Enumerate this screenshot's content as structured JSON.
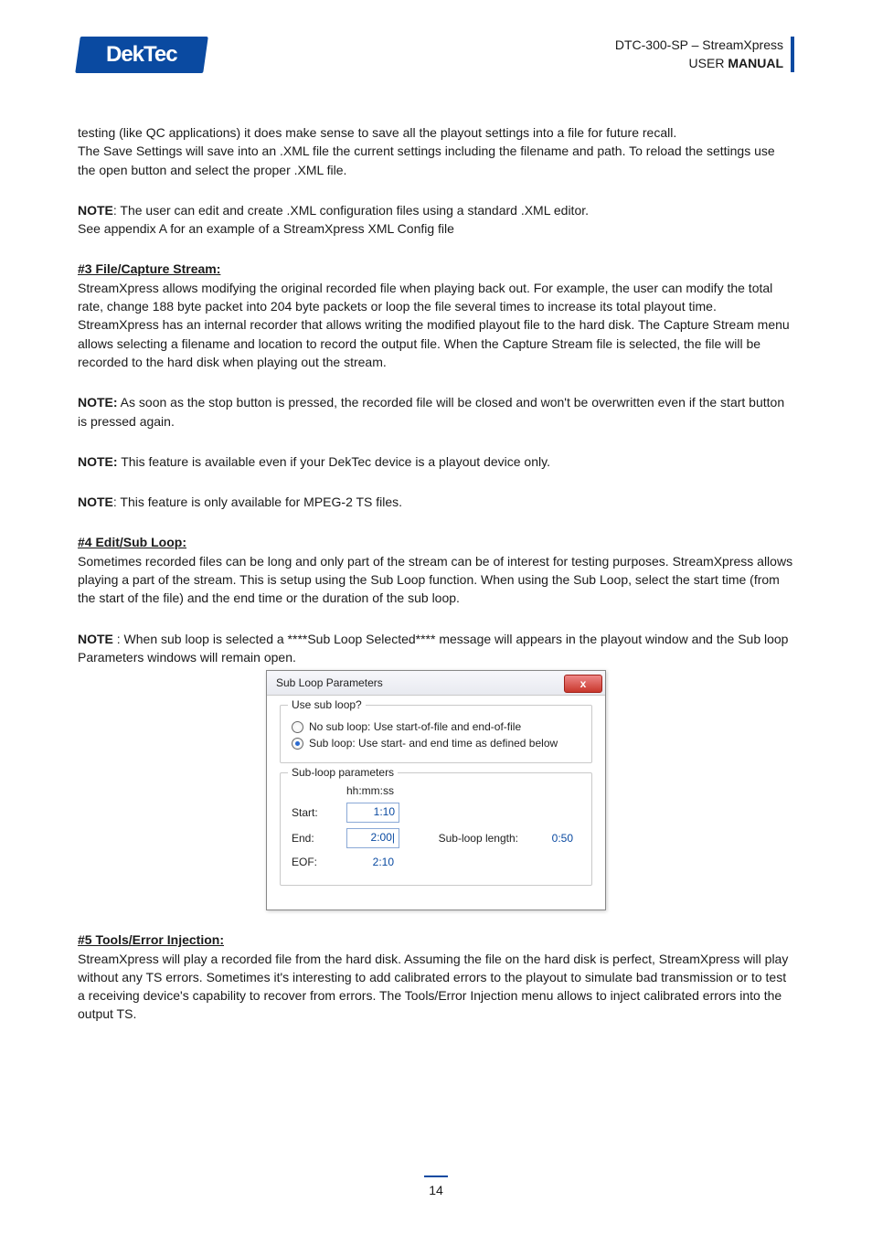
{
  "header": {
    "logo_text": "DekTec",
    "product": "DTC-300-SP – StreamXpress",
    "doc_type_prefix": "USER",
    "doc_type_bold": "MANUAL"
  },
  "body": {
    "p1": "testing (like QC applications) it does make sense to save all the playout settings into a file for future recall.",
    "p2": "The Save Settings will save into an .XML file the current settings including the filename and path. To reload the settings use the open button and select the proper .XML file.",
    "note1_label": "NOTE",
    "note1_text": ": The user can edit and create .XML configuration files using a standard .XML editor.",
    "note1_cont": "See appendix A for an example of a StreamXpress XML Config file",
    "h3": "#3 File/Capture Stream:",
    "p3": "StreamXpress allows modifying the original recorded file when playing back out. For example, the user can modify the total rate, change 188 byte packet into 204 byte packets or loop the file several times to increase its total playout time. StreamXpress has an internal recorder that allows writing the modified playout file to the hard disk. The Capture Stream menu allows selecting a filename and location to record the output file. When the Capture Stream file is selected, the file will be recorded to the hard disk when playing out the stream.",
    "note2_label": "NOTE:",
    "note2_text": " As soon as the stop button is pressed, the recorded file will be closed and won't be overwritten even if the start button is pressed again.",
    "note3_label": "NOTE:",
    "note3_text": " This feature is available even if your DekTec device is a playout device only.",
    "note4_label": "NOTE",
    "note4_text": ": This feature is only available for MPEG-2 TS files.",
    "h4": "#4 Edit/Sub Loop:",
    "p4": "Sometimes recorded files can be long and only part of the stream can be of interest for testing purposes. StreamXpress allows playing a part of the stream. This is setup using the Sub Loop function. When using the Sub Loop, select the start time (from the start of the file) and the end time or the duration of the sub loop.",
    "note5_label": "NOTE",
    "note5_text": " : When sub loop is selected a ****Sub Loop Selected**** message will appears in the playout window and the Sub loop Parameters windows will remain open.",
    "h5": "#5 Tools/Error Injection:",
    "p5": "StreamXpress will play a recorded file from the hard disk. Assuming the file on the hard disk is perfect, StreamXpress will play without any TS errors. Sometimes it's interesting to add calibrated errors to the playout to simulate bad transmission or to test a receiving device's capability to recover from errors. The Tools/Error Injection menu allows to inject calibrated errors into the output TS."
  },
  "dialog": {
    "title": "Sub Loop Parameters",
    "close_glyph": "x",
    "group1_title": "Use sub loop?",
    "radio1": "No sub loop: Use start-of-file and end-of-file",
    "radio2": "Sub loop: Use start- and end time as defined below",
    "group2_title": "Sub-loop parameters",
    "col_hh": "hh:mm:ss",
    "row_start_label": "Start:",
    "row_start_val": "1:10",
    "row_end_label": "End:",
    "row_end_val": "2:00|",
    "row_len_label": "Sub-loop length:",
    "row_len_val": "0:50",
    "row_eof_label": "EOF:",
    "row_eof_val": "2:10"
  },
  "footer": {
    "page_number": "14"
  }
}
